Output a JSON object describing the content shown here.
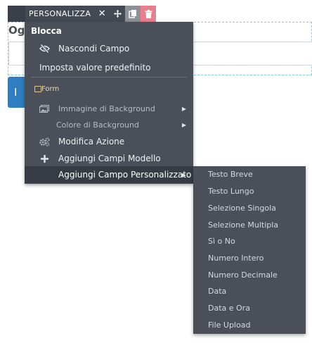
{
  "page": {
    "field_label": "Og",
    "button_text": "I"
  },
  "toolbar": {
    "title": "PERSONALIZZA",
    "close_symbol": "✕",
    "icons": [
      "close-icon",
      "move-icon",
      "copy-icon",
      "trash-icon"
    ]
  },
  "menu": {
    "header": "Blocca",
    "items": [
      {
        "label": "Nascondi Campo",
        "icon": "eye-slash-icon"
      },
      {
        "label": "Imposta valore predefinito"
      },
      {
        "label": "Form",
        "icon": "checkbox-icon"
      },
      {
        "label": "Immagine di Background",
        "icon": "image-icon",
        "submenu": true
      },
      {
        "label": "Colore di Background",
        "submenu": true
      },
      {
        "label": "Modifica Azione",
        "icon": "cogs-icon"
      },
      {
        "label": "Aggiungi Campi Modello",
        "icon": "plus-icon"
      },
      {
        "label": "Aggiungi Campo Personalizzato",
        "submenu": true,
        "active": true
      }
    ],
    "arrow_symbol": "▶"
  },
  "submenu": {
    "items": [
      "Testo Breve",
      "Testo Lungo",
      "Selezione Singola",
      "Selezione Multipla",
      "Sì o No",
      "Numero Intero",
      "Numero Decimale",
      "Data",
      "Data e Ora",
      "File Upload"
    ]
  },
  "colors": {
    "menu_bg": "#4a4f59",
    "toolbar_bg": "#444a54",
    "delete_bg": "#e87f8f",
    "accent_blue": "#2f7ec2",
    "selection_outline": "#7fd0e4"
  }
}
